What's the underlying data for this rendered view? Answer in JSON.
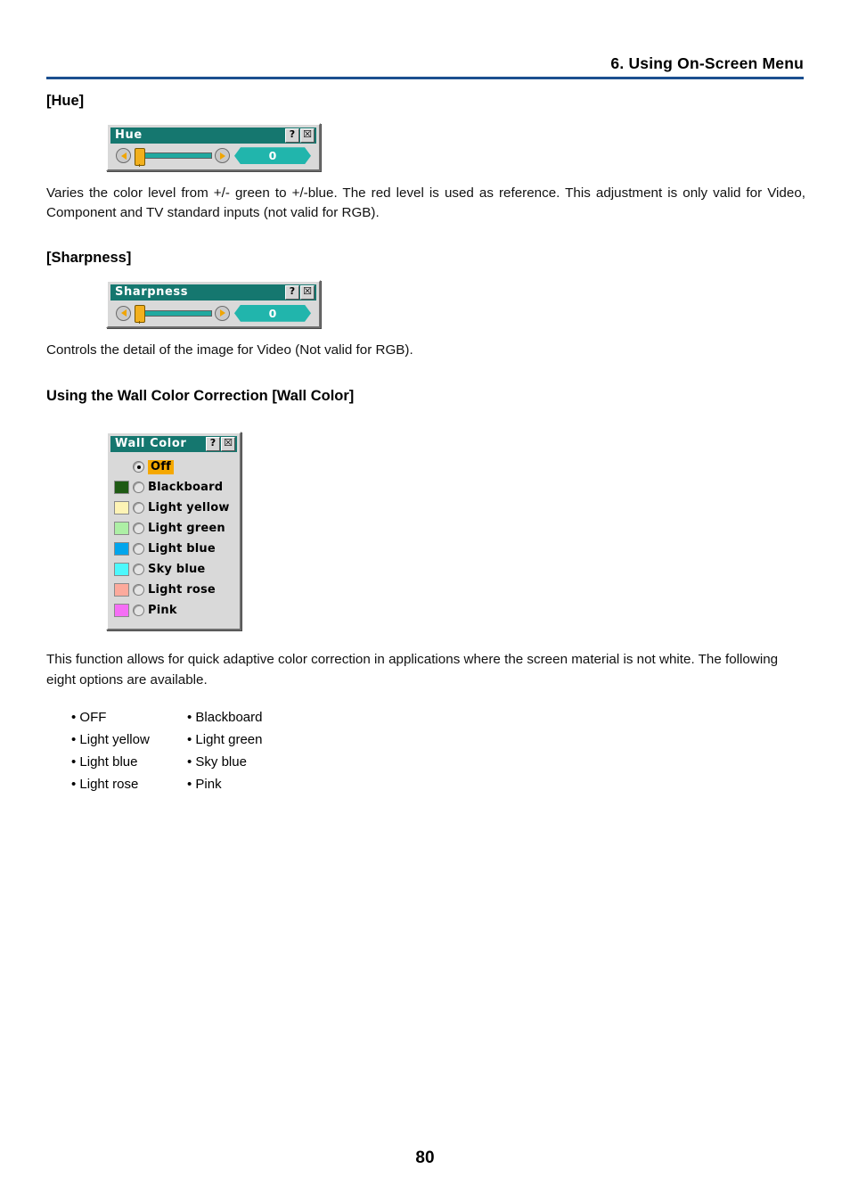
{
  "header": {
    "title": "6. Using On-Screen Menu",
    "rule_color": "#1b4f8f"
  },
  "sections": {
    "hue": {
      "heading": "[Hue]",
      "body": "Varies the color level from +/- green to +/-blue. The red level is used as reference. This adjustment is only valid for Video, Component and TV standard inputs (not valid for RGB).",
      "dialog": {
        "title": "Hue",
        "help_button": "?",
        "close_button": "☒",
        "left_arrow": "left-arrow",
        "right_arrow": "right-arrow",
        "value": "0"
      }
    },
    "sharpness": {
      "heading": "[Sharpness]",
      "body": "Controls the detail of the image for Video (Not valid for RGB).",
      "dialog": {
        "title": "Sharpness",
        "help_button": "?",
        "close_button": "☒",
        "left_arrow": "left-arrow",
        "right_arrow": "right-arrow",
        "value": "0"
      }
    },
    "wall_color": {
      "heading": "Using the Wall Color Correction [Wall Color]",
      "body": "This function allows for quick adaptive color correction in applications where the screen material is not white. The following eight options are available.",
      "dialog": {
        "title": "Wall Color",
        "help_button": "?",
        "close_button": "☒",
        "items": [
          {
            "label": "Off",
            "swatch": "",
            "selected": true,
            "highlight": true
          },
          {
            "label": "Blackboard",
            "swatch": "#1e5a14",
            "selected": false,
            "highlight": false
          },
          {
            "label": "Light yellow",
            "swatch": "#fdf3b5",
            "selected": false,
            "highlight": false
          },
          {
            "label": "Light green",
            "swatch": "#adefa5",
            "selected": false,
            "highlight": false
          },
          {
            "label": "Light blue",
            "swatch": "#01a5ec",
            "selected": false,
            "highlight": false
          },
          {
            "label": "Sky blue",
            "swatch": "#4df8fc",
            "selected": false,
            "highlight": false
          },
          {
            "label": "Light rose",
            "swatch": "#fcaa9c",
            "selected": false,
            "highlight": false
          },
          {
            "label": "Pink",
            "swatch": "#f56ef5",
            "selected": false,
            "highlight": false
          }
        ]
      },
      "options": [
        {
          "left": "• OFF",
          "right": "• Blackboard"
        },
        {
          "left": "• Light yellow",
          "right": "• Light green"
        },
        {
          "left": "• Light blue",
          "right": "• Sky blue"
        },
        {
          "left": "• Light rose",
          "right": "• Pink"
        }
      ]
    }
  },
  "footer": {
    "page_number": "80"
  },
  "colors": {
    "titlebar": "#15776f",
    "dialog_face": "#d9d9d9",
    "value_box": "#21b5ac",
    "slider_track": "#21a9a0",
    "thumb": "#f2b01e",
    "highlight": "#f5a800",
    "header_rule": "#1b4f8f"
  }
}
